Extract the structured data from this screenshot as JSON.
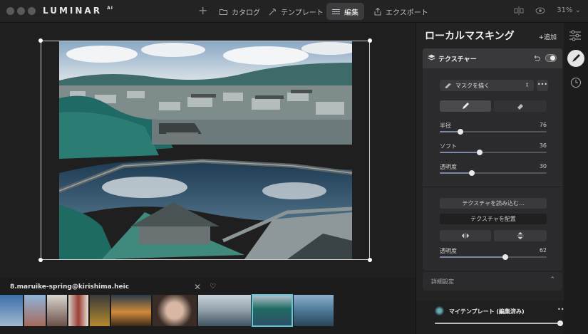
{
  "app": {
    "logo": "LUMINAR",
    "logo_sup": "AI"
  },
  "topbar": {
    "tabs": [
      {
        "label": "カタログ",
        "icon": "folder-icon"
      },
      {
        "label": "テンプレート",
        "icon": "wand-icon"
      },
      {
        "label": "編集",
        "icon": "sliders-icon",
        "active": true
      },
      {
        "label": "エクスポート",
        "icon": "share-icon"
      }
    ],
    "zoom": "31%"
  },
  "file": {
    "name": "8.maruike-spring@kirishima.heic"
  },
  "panel": {
    "title": "ローカルマスキング",
    "add_label": "+追加",
    "layer_title": "テクスチャー",
    "mask_select": "マスクを描く",
    "more": "•••",
    "sliders": [
      {
        "label": "半径",
        "value": 76,
        "fraction": 0.19
      },
      {
        "label": "ソフト",
        "value": 36,
        "fraction": 0.37
      },
      {
        "label": "透明度",
        "value": 30,
        "fraction": 0.3
      }
    ],
    "load_texture": "テクスチャを読み込む...",
    "place_texture": "テクスチャを配置",
    "opacity2": {
      "label": "透明度",
      "value": 62,
      "fraction": 0.61
    },
    "details": "詳細設定",
    "template_name": "マイテンプレート (編集済み)",
    "template_more": "•••"
  },
  "colors": {
    "accent": "#5ec8d8",
    "panel_bg": "#232324"
  }
}
